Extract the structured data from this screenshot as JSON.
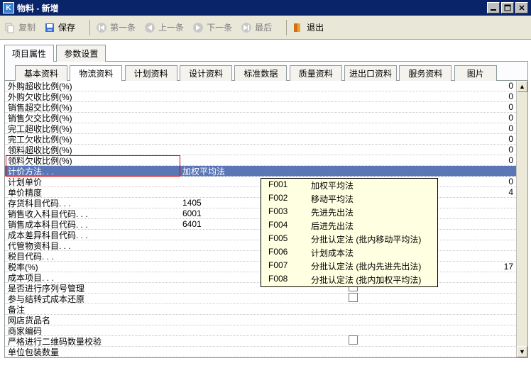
{
  "window": {
    "icon_letter": "K",
    "title": "物料 - 新增"
  },
  "toolbar": {
    "copy": "复制",
    "save": "保存",
    "first": "第一条",
    "prev": "上一条",
    "next": "下一条",
    "last": "最后",
    "exit": "退出"
  },
  "main_tabs": {
    "t0": "项目属性",
    "t1": "参数设置"
  },
  "sub_tabs": {
    "s0": "基本资料",
    "s1": "物流资料",
    "s2": "计划资料",
    "s3": "设计资料",
    "s4": "标准数据",
    "s5": "质量资料",
    "s6": "进出口资料",
    "s7": "服务资料",
    "s8": "图片"
  },
  "rows": [
    {
      "label": "外购超收比例(%)",
      "rval": "0"
    },
    {
      "label": "外购欠收比例(%)",
      "rval": "0"
    },
    {
      "label": "销售超交比例(%)",
      "rval": "0"
    },
    {
      "label": "销售欠交比例(%)",
      "rval": "0"
    },
    {
      "label": "完工超收比例(%)",
      "rval": "0"
    },
    {
      "label": "完工欠收比例(%)",
      "rval": "0"
    },
    {
      "label": "领料超收比例(%)",
      "rval": "0"
    },
    {
      "label": "领料欠收比例(%)",
      "rval": "0"
    },
    {
      "label": "计价方法. . .",
      "val": "加权平均法",
      "selected": true
    },
    {
      "label": "计划单价",
      "rval": "0"
    },
    {
      "label": "单价精度",
      "rval": "4"
    },
    {
      "label": "存货科目代码. . .",
      "val": "1405"
    },
    {
      "label": "销售收入科目代码. . .",
      "val": "6001"
    },
    {
      "label": "销售成本科目代码. . .",
      "val": "6401"
    },
    {
      "label": "成本差异科目代码. . ."
    },
    {
      "label": "代管物资科目. . ."
    },
    {
      "label": "税目代码. . ."
    },
    {
      "label": "税率(%)",
      "rval": "17"
    },
    {
      "label": "成本项目. . ."
    },
    {
      "label": "是否进行序列号管理",
      "chk": true
    },
    {
      "label": "参与结转式成本还原",
      "chk": true
    },
    {
      "label": "备注"
    },
    {
      "label": "网店货品名"
    },
    {
      "label": "商家编码"
    },
    {
      "label": "严格进行二维码数量校验",
      "chk": true
    },
    {
      "label": "单位包装数量"
    }
  ],
  "dropdown": [
    {
      "code": "F001",
      "txt": "加权平均法"
    },
    {
      "code": "F002",
      "txt": "移动平均法"
    },
    {
      "code": "F003",
      "txt": "先进先出法"
    },
    {
      "code": "F004",
      "txt": "后进先出法"
    },
    {
      "code": "F005",
      "txt": "分批认定法 (批内移动平均法)"
    },
    {
      "code": "F006",
      "txt": "计划成本法"
    },
    {
      "code": "F007",
      "txt": "分批认定法 (批内先进先出法)"
    },
    {
      "code": "F008",
      "txt": "分批认定法 (批内加权平均法)"
    }
  ]
}
